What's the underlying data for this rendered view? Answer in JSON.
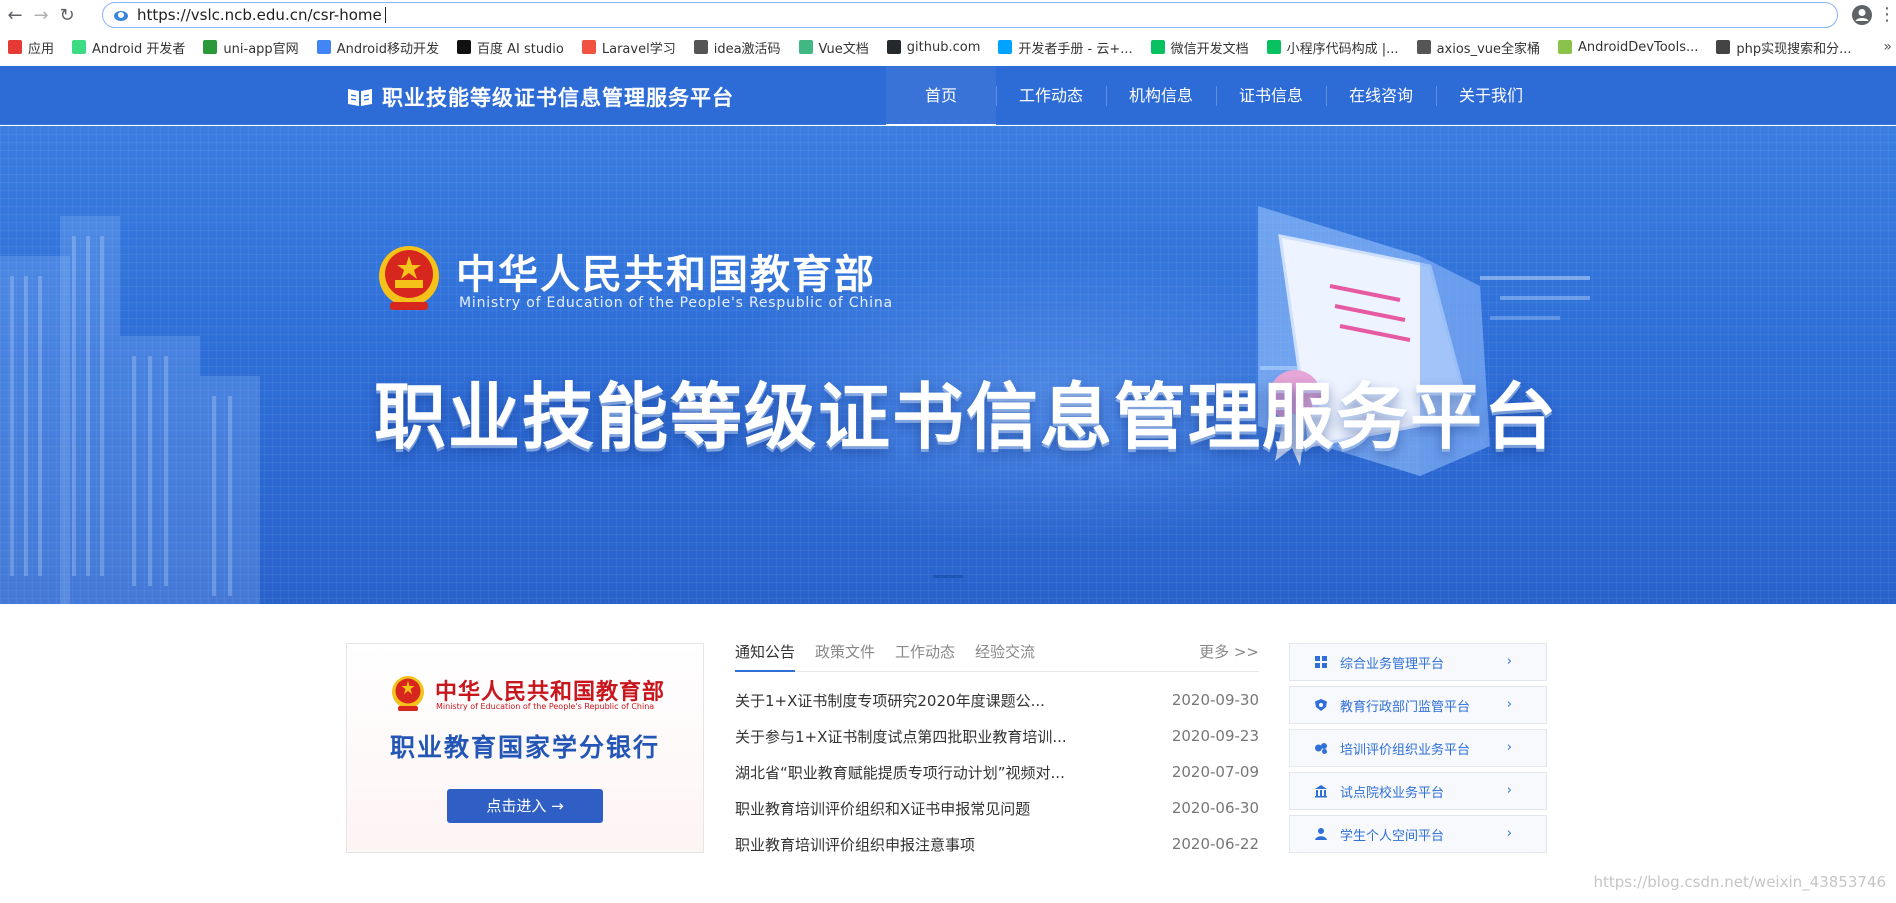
{
  "browser": {
    "url": "https://vslc.ncb.edu.cn/csr-home",
    "bookmarks": [
      {
        "label": "应用",
        "icon": "apps-grid-icon",
        "color": "#e53935"
      },
      {
        "label": "Android 开发者",
        "icon": "android-icon",
        "color": "#3ddc84"
      },
      {
        "label": "uni-app官网",
        "icon": "uniapp-icon",
        "color": "#2b9939"
      },
      {
        "label": "Android移动开发",
        "icon": "android-dev-icon",
        "color": "#4285f4"
      },
      {
        "label": "百度 AI studio",
        "icon": "ai-studio-icon",
        "color": "#111111"
      },
      {
        "label": "Laravel学习",
        "icon": "laravel-icon",
        "color": "#f05340"
      },
      {
        "label": "idea激活码",
        "icon": "globe-icon",
        "color": "#555555"
      },
      {
        "label": "Vue文档",
        "icon": "vue-icon",
        "color": "#41b883"
      },
      {
        "label": "github.com",
        "icon": "github-icon",
        "color": "#24292e"
      },
      {
        "label": "开发者手册 - 云+...",
        "icon": "cloud-icon",
        "color": "#00a3ff"
      },
      {
        "label": "微信开发文档",
        "icon": "wechat-icon",
        "color": "#07c160"
      },
      {
        "label": "小程序代码构成 |...",
        "icon": "wechat-icon",
        "color": "#07c160"
      },
      {
        "label": "axios_vue全家桶",
        "icon": "globe-icon",
        "color": "#555555"
      },
      {
        "label": "AndroidDevTools...",
        "icon": "devtools-icon",
        "color": "#8bc34a"
      },
      {
        "label": "php实现搜索和分...",
        "icon": "php-icon",
        "color": "#444444"
      }
    ],
    "more_bookmarks": "»"
  },
  "header": {
    "site_title": "职业技能等级证书信息管理服务平台",
    "nav": [
      {
        "label": "首页",
        "active": true
      },
      {
        "label": "工作动态",
        "active": false
      },
      {
        "label": "机构信息",
        "active": false
      },
      {
        "label": "证书信息",
        "active": false
      },
      {
        "label": "在线咨询",
        "active": false
      },
      {
        "label": "关于我们",
        "active": false
      }
    ]
  },
  "banner": {
    "ministry_cn": "中华人民共和国教育部",
    "ministry_en": "Ministry of Education of the People's Respublic of China",
    "title": "职业技能等级证书信息管理服务平台"
  },
  "credit_bank": {
    "ministry_cn": "中华人民共和国教育部",
    "ministry_en": "Ministry of Education of the People's Republic of China",
    "title": "职业教育国家学分银行",
    "button": "点击进入"
  },
  "news": {
    "tabs": [
      "通知公告",
      "政策文件",
      "工作动态",
      "经验交流"
    ],
    "active_tab": 0,
    "more": "更多 >>",
    "items": [
      {
        "title": "关于1+X证书制度专项研究2020年度课题公...",
        "date": "2020-09-30"
      },
      {
        "title": "关于参与1+X证书制度试点第四批职业教育培训...",
        "date": "2020-09-23"
      },
      {
        "title": "湖北省“职业教育赋能提质专项行动计划”视频对...",
        "date": "2020-07-09"
      },
      {
        "title": "职业教育培训评价组织和X证书申报常见问题",
        "date": "2020-06-30"
      },
      {
        "title": "职业教育培训评价组织申报注意事项",
        "date": "2020-06-22"
      }
    ]
  },
  "platforms": [
    {
      "label": "综合业务管理平台",
      "icon": "dashboard-icon"
    },
    {
      "label": "教育行政部门监管平台",
      "icon": "shield-icon"
    },
    {
      "label": "培训评价组织业务平台",
      "icon": "training-icon"
    },
    {
      "label": "试点院校业务平台",
      "icon": "school-icon"
    },
    {
      "label": "学生个人空间平台",
      "icon": "user-icon"
    }
  ],
  "watermark": "https://blog.csdn.net/weixin_43853746",
  "colors": {
    "brand": "#2d6bd6",
    "accent_link": "#2f6fd8",
    "ministry_red": "#c8161d"
  }
}
